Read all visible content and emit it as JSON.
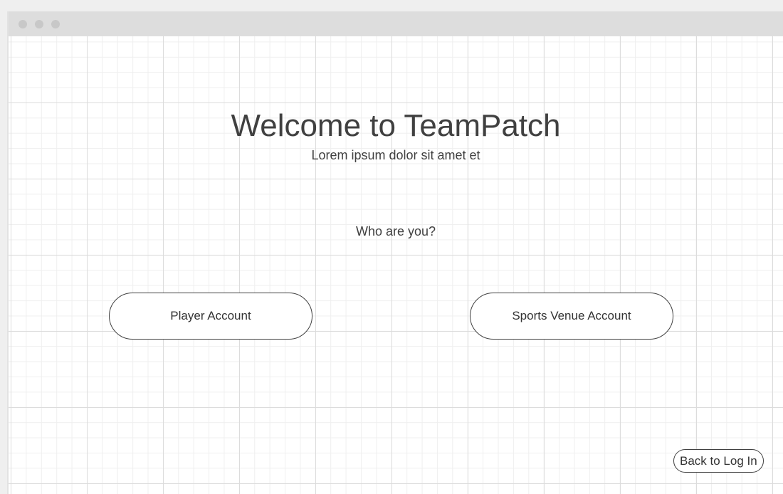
{
  "window": {
    "controls": [
      "close-dot",
      "minimize-dot",
      "maximize-dot"
    ]
  },
  "main": {
    "title": "Welcome to TeamPatch",
    "subtitle": "Lorem ipsum dolor sit amet et",
    "question": "Who are you?",
    "player_button_label": "Player Account",
    "venue_button_label": "Sports Venue Account",
    "back_button_label": "Back to Log In"
  }
}
